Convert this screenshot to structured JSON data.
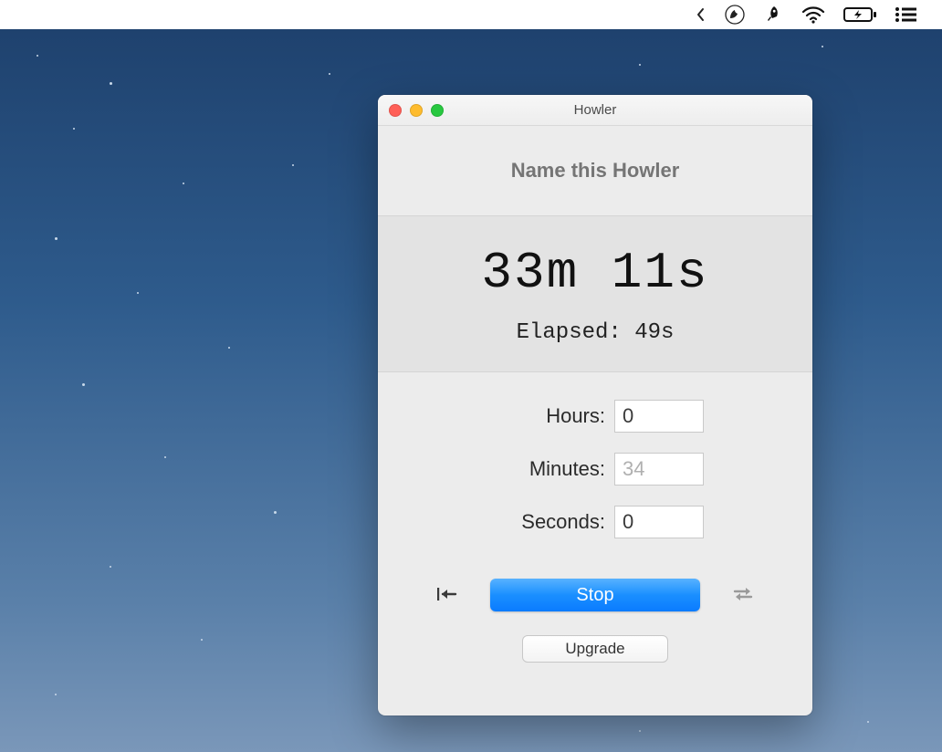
{
  "window": {
    "title": "Howler",
    "name_placeholder": "Name this Howler",
    "big_time": "33m 11s",
    "elapsed": "Elapsed: 49s",
    "labels": {
      "hours": "Hours:",
      "minutes": "Minutes:",
      "seconds": "Seconds:"
    },
    "values": {
      "hours": "0",
      "minutes": "34",
      "seconds": "0"
    },
    "stop_label": "Stop",
    "upgrade_label": "Upgrade"
  }
}
